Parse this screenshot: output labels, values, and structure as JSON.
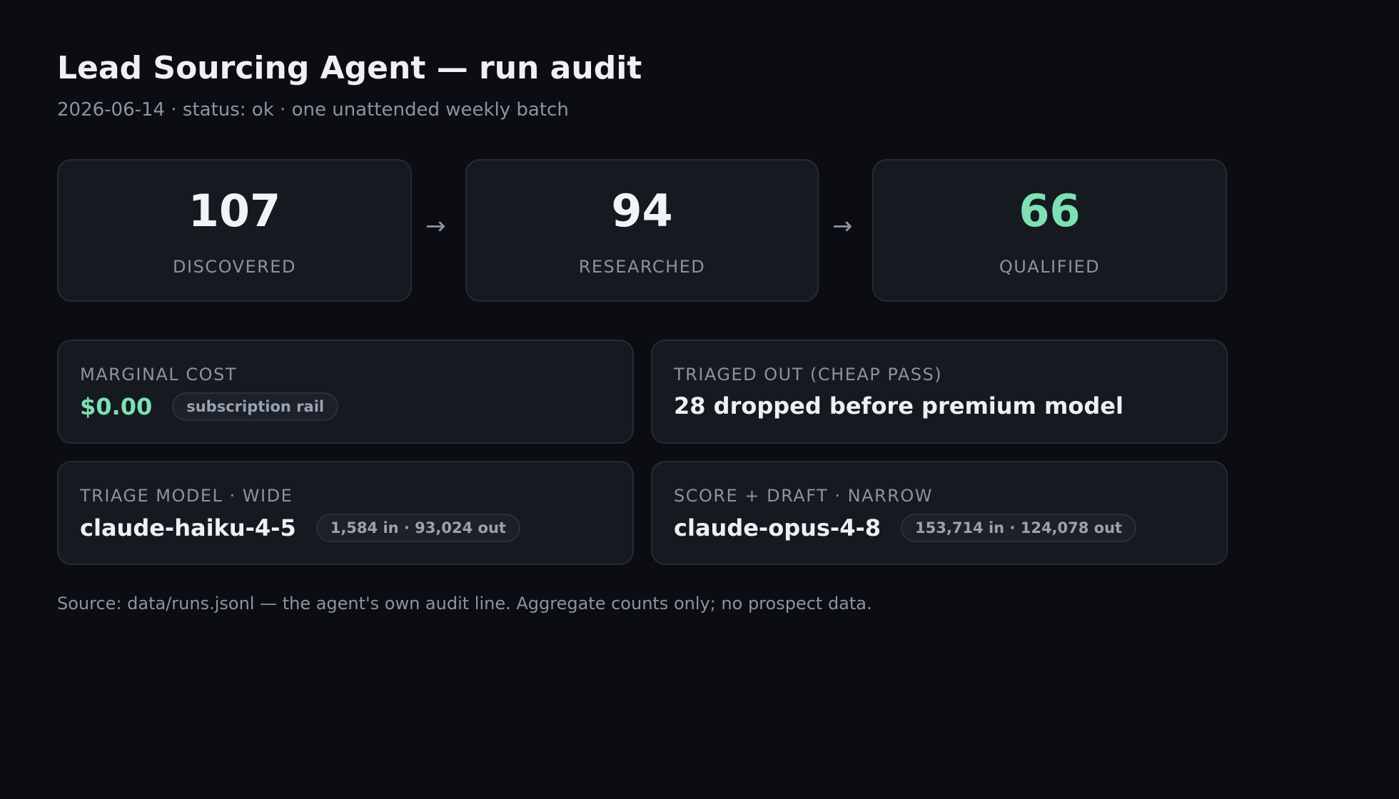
{
  "header": {
    "title": "Lead Sourcing Agent — run audit",
    "subtitle": "2026-06-14 · status: ok · one unattended weekly batch"
  },
  "funnel": {
    "arrow": "→",
    "stages": [
      {
        "value": "107",
        "label": "DISCOVERED"
      },
      {
        "value": "94",
        "label": "RESEARCHED"
      },
      {
        "value": "66",
        "label": "QUALIFIED"
      }
    ]
  },
  "cards": {
    "marginal_cost": {
      "label": "MARGINAL COST",
      "value": "$0.00",
      "pill": "subscription rail"
    },
    "triaged_out": {
      "label": "TRIAGED OUT (CHEAP PASS)",
      "value": "28 dropped before premium model"
    },
    "triage_model": {
      "label": "TRIAGE MODEL · WIDE",
      "value": "claude-haiku-4-5",
      "pill": "1,584 in · 93,024 out"
    },
    "score_model": {
      "label": "SCORE + DRAFT · NARROW",
      "value": "claude-opus-4-8",
      "pill": "153,714 in · 124,078 out"
    }
  },
  "footer": {
    "source": "Source: data/runs.jsonl — the agent's own audit line. Aggregate counts only; no prospect data."
  },
  "colors": {
    "background": "#0b0d12",
    "card": "#151920",
    "accent": "#7ee0b4",
    "muted": "#8b93a3"
  }
}
